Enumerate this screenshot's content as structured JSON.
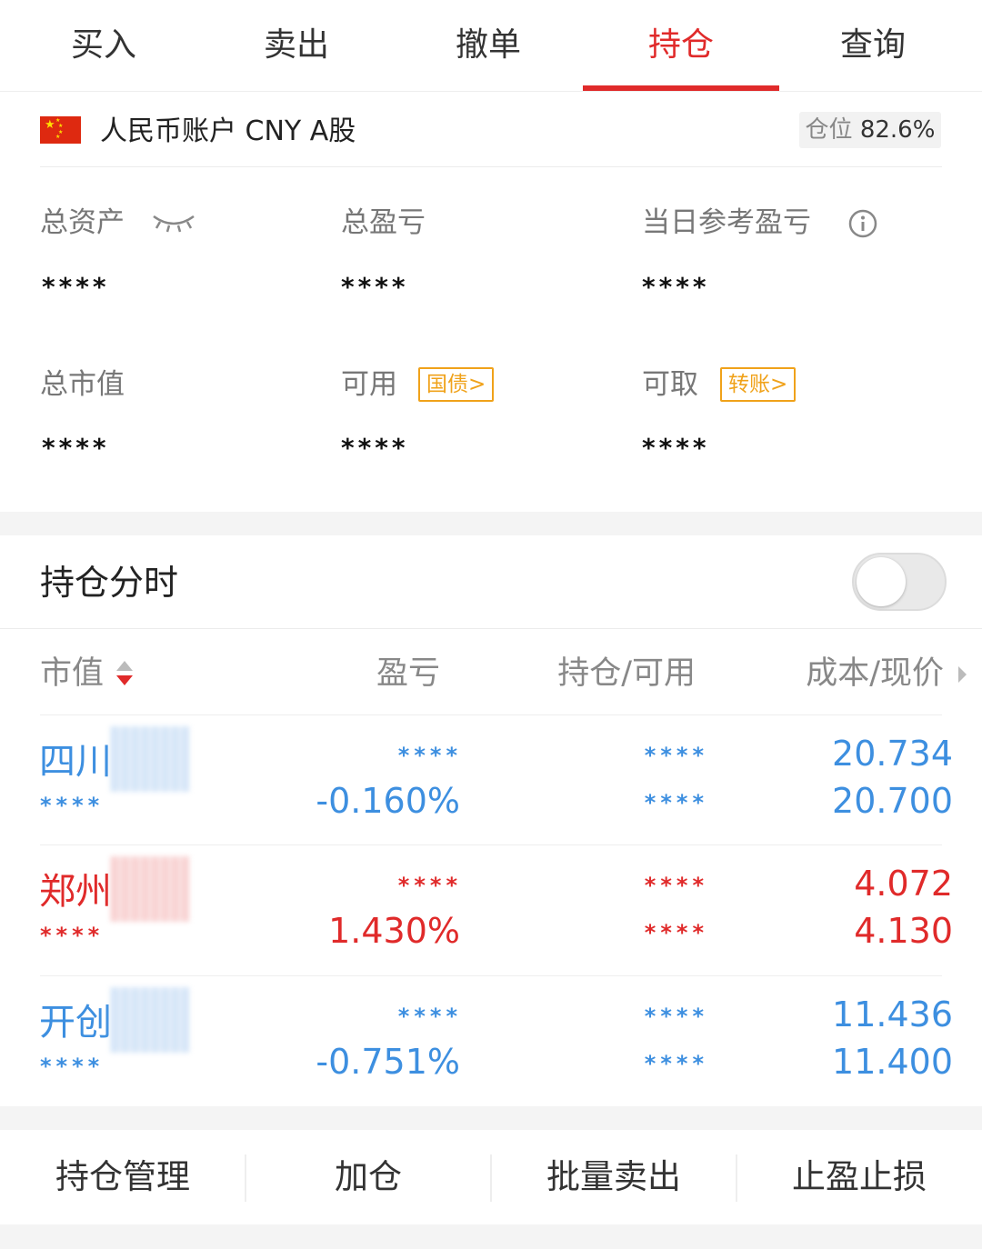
{
  "tabs": [
    {
      "label": "买入"
    },
    {
      "label": "卖出"
    },
    {
      "label": "撤单"
    },
    {
      "label": "持仓",
      "active": true
    },
    {
      "label": "查询"
    }
  ],
  "account": {
    "name": "人民币账户 CNY A股",
    "flag": "china-flag",
    "position_label": "仓位",
    "position_value": "82.6%"
  },
  "metrics": {
    "total_assets": {
      "label": "总资产",
      "value": "****"
    },
    "total_pnl": {
      "label": "总盈亏",
      "value": "****"
    },
    "today_pnl": {
      "label": "当日参考盈亏",
      "value": "****"
    },
    "market_value": {
      "label": "总市值",
      "value": "****"
    },
    "available": {
      "label": "可用",
      "tag": "国债>",
      "value": "****"
    },
    "withdrawable": {
      "label": "可取",
      "tag": "转账>",
      "value": "****"
    }
  },
  "intraday": {
    "title": "持仓分时",
    "toggle_on": false
  },
  "table": {
    "headers": {
      "market_value": "市值",
      "pnl": "盈亏",
      "position": "持仓/可用",
      "cost_price": "成本/现价"
    },
    "rows": [
      {
        "name": "四川",
        "color": "#3d8fe0",
        "sub": "****",
        "pnl_amount": "****",
        "pnl_pct": "-0.160%",
        "position": "****",
        "available": "****",
        "cost": "20.734",
        "price": "20.700"
      },
      {
        "name": "郑州",
        "color": "#e02a2a",
        "sub": "****",
        "pnl_amount": "****",
        "pnl_pct": "1.430%",
        "position": "****",
        "available": "****",
        "cost": "4.072",
        "price": "4.130"
      },
      {
        "name": "开创",
        "color": "#3d8fe0",
        "sub": "****",
        "pnl_amount": "****",
        "pnl_pct": "-0.751%",
        "position": "****",
        "available": "****",
        "cost": "11.436",
        "price": "11.400"
      }
    ]
  },
  "actions": [
    {
      "label": "持仓管理"
    },
    {
      "label": "加仓"
    },
    {
      "label": "批量卖出"
    },
    {
      "label": "止盈止损"
    }
  ],
  "colors": {
    "accent_red": "#e02a2a",
    "up": "#e02a2a",
    "down": "#3d8fe0",
    "tag_orange": "#f0a21a"
  }
}
